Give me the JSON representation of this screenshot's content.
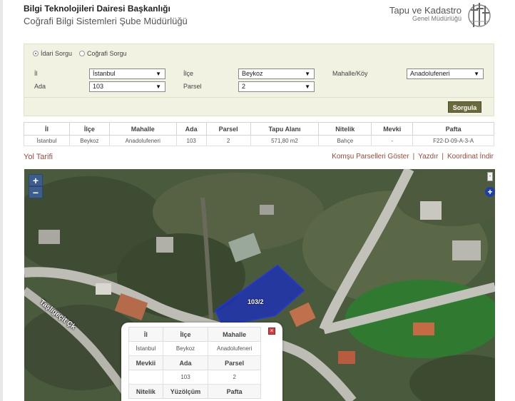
{
  "header": {
    "title": "Bilgi Teknolojileri Dairesi Başkanlığı",
    "subtitle": "Coğrafi Bilgi Sistemleri Şube Müdürlüğü",
    "brand_line1": "Tapu ve Kadastro",
    "brand_line2": "Genel Müdürlüğü"
  },
  "query": {
    "radio_admin": "İdari Sorgu",
    "radio_geo": "Coğrafi Sorgu",
    "il_label": "İl",
    "il_value": "İstanbul",
    "ilce_label": "İlçe",
    "ilce_value": "Beykoz",
    "mahalle_label": "Mahalle/Köy",
    "mahalle_value": "Anadolufeneri",
    "ada_label": "Ada",
    "ada_value": "103",
    "parsel_label": "Parsel",
    "parsel_value": "2",
    "submit_label": "Sorgula"
  },
  "results": {
    "headers": [
      "İl",
      "İlçe",
      "Mahalle",
      "Ada",
      "Parsel",
      "Tapu Alanı",
      "Nitelik",
      "Mevki",
      "Pafta"
    ],
    "row": [
      "İstanbul",
      "Beykoz",
      "Anadolufeneri",
      "103",
      "2",
      "571,80 m2",
      "Bahçe",
      "-",
      "F22-D-09-A-3-A"
    ]
  },
  "links": {
    "route": "Yol Tarifi",
    "neighbors": "Komşu Parselleri Göster",
    "print": "Yazdır",
    "coordinates": "Koordinat İndir",
    "separator": "|"
  },
  "map": {
    "zoom_in": "+",
    "zoom_out": "−",
    "collapse": "-",
    "add": "+",
    "parcel_label": "103/2",
    "street_label": "Taşlıgeçit Çk",
    "parcel_color": "#1a2ec2"
  },
  "popup": {
    "close": "×",
    "h1": [
      "İl",
      "İlçe",
      "Mahalle"
    ],
    "r1": [
      "İstanbul",
      "Beykoz",
      "Anadolufeneri"
    ],
    "h2": [
      "Mevkii",
      "Ada",
      "Parsel"
    ],
    "r2": [
      "",
      "103",
      "2"
    ],
    "h3": [
      "Nitelik",
      "Yüzölçüm",
      "Pafta"
    ]
  }
}
